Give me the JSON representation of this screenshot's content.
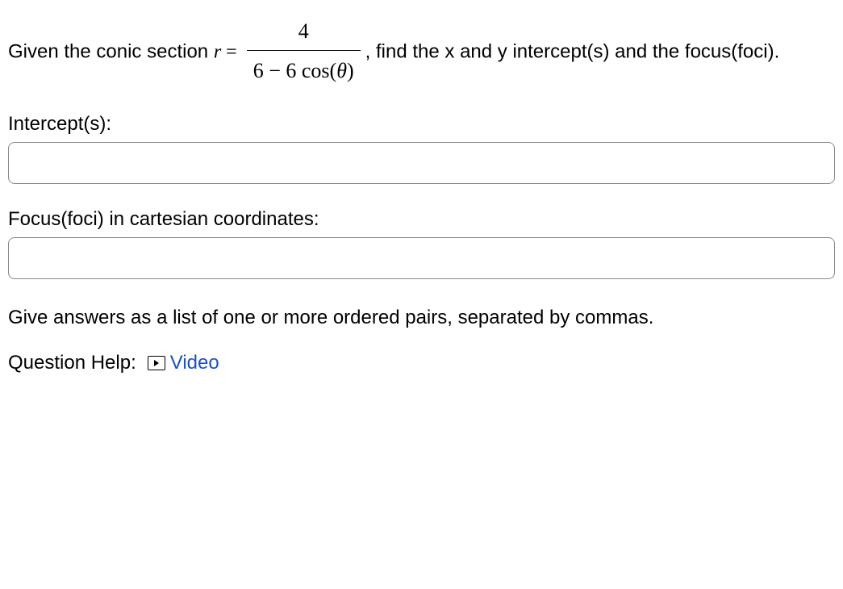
{
  "problem": {
    "pre": "Given the conic section ",
    "var_r": "r",
    "eq": " = ",
    "frac_num": "4",
    "frac_den_a": "6",
    "frac_den_minus": " − ",
    "frac_den_b": "6",
    "frac_den_cos": " cos",
    "frac_den_open": "(",
    "frac_den_theta": "θ",
    "frac_den_close": ")",
    "post_comma": ", ",
    "post": "find the x and y intercept(s) and the focus(foci)."
  },
  "labels": {
    "intercepts": "Intercept(s):",
    "foci": "Focus(foci) in cartesian coordinates:"
  },
  "inputs": {
    "intercepts_value": "",
    "foci_value": ""
  },
  "instructions": "Give answers as a list of one or more ordered pairs, separated by commas.",
  "help": {
    "label": "Question Help:",
    "video": "Video"
  }
}
